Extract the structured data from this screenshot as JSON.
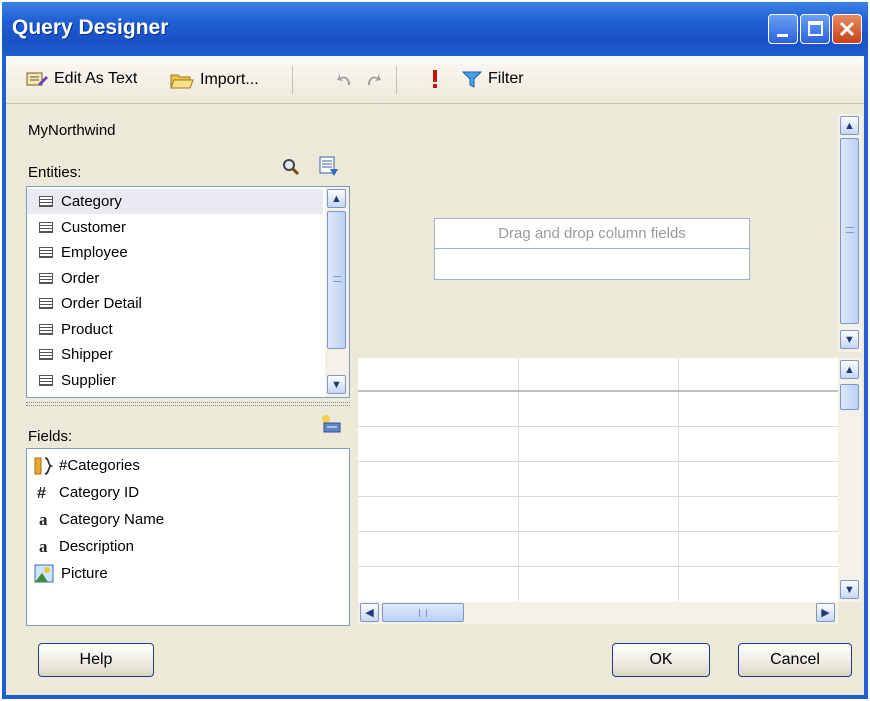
{
  "window": {
    "title": "Query Designer"
  },
  "toolbar": {
    "edit_as_text": "Edit As Text",
    "import": "Import...",
    "filter": "Filter"
  },
  "left": {
    "datasource": "MyNorthwind",
    "entities_label": "Entities:",
    "entities": [
      "Category",
      "Customer",
      "Employee",
      "Order",
      "Order Detail",
      "Product",
      "Shipper",
      "Supplier"
    ],
    "selected_entity": "Category",
    "fields_label": "Fields:",
    "fields": [
      {
        "icon": "folder-bracket-icon",
        "label": "#Categories"
      },
      {
        "icon": "number-hash-icon",
        "label": "Category ID"
      },
      {
        "icon": "text-a-icon",
        "label": "Category Name"
      },
      {
        "icon": "text-a-icon",
        "label": "Description"
      },
      {
        "icon": "picture-icon",
        "label": "Picture"
      }
    ]
  },
  "design": {
    "drop_placeholder": "Drag and drop column fields"
  },
  "buttons": {
    "help": "Help",
    "ok": "OK",
    "cancel": "Cancel"
  }
}
